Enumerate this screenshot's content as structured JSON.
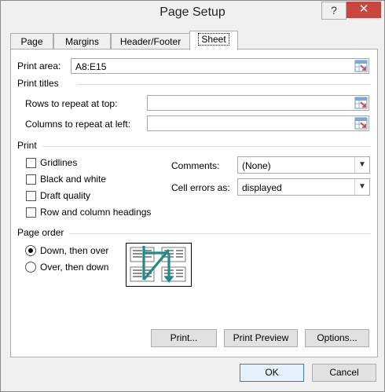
{
  "window": {
    "title": "Page Setup",
    "help_label": "?",
    "close_label": "✕"
  },
  "tabs": [
    {
      "label": "Page",
      "active": false
    },
    {
      "label": "Margins",
      "active": false
    },
    {
      "label": "Header/Footer",
      "active": false
    },
    {
      "label": "Sheet",
      "active": true
    }
  ],
  "print_area": {
    "label": "Print area:",
    "value": "A8:E15"
  },
  "print_titles": {
    "heading": "Print titles",
    "rows_label": "Rows to repeat at top:",
    "rows_value": "",
    "cols_label": "Columns to repeat at left:",
    "cols_value": ""
  },
  "print": {
    "heading": "Print",
    "gridlines": {
      "label": "Gridlines",
      "checked": false
    },
    "black_white": {
      "label": "Black and white",
      "checked": false
    },
    "draft": {
      "label": "Draft quality",
      "checked": false
    },
    "headings": {
      "label": "Row and column headings",
      "checked": false
    },
    "comments_label": "Comments:",
    "comments_value": "(None)",
    "errors_label": "Cell errors as:",
    "errors_value": "displayed"
  },
  "page_order": {
    "heading": "Page order",
    "down_over": {
      "label": "Down, then over",
      "selected": true
    },
    "over_down": {
      "label": "Over, then down",
      "selected": false
    }
  },
  "buttons": {
    "print": "Print...",
    "preview": "Print Preview",
    "options": "Options...",
    "ok": "OK",
    "cancel": "Cancel"
  },
  "colors": {
    "close": "#c8463e",
    "arrow": "#1e8a8a",
    "accent": "#3c7fb1"
  },
  "icons": {
    "ref": "range-selector-icon",
    "dropdown": "chevron-down-icon"
  }
}
